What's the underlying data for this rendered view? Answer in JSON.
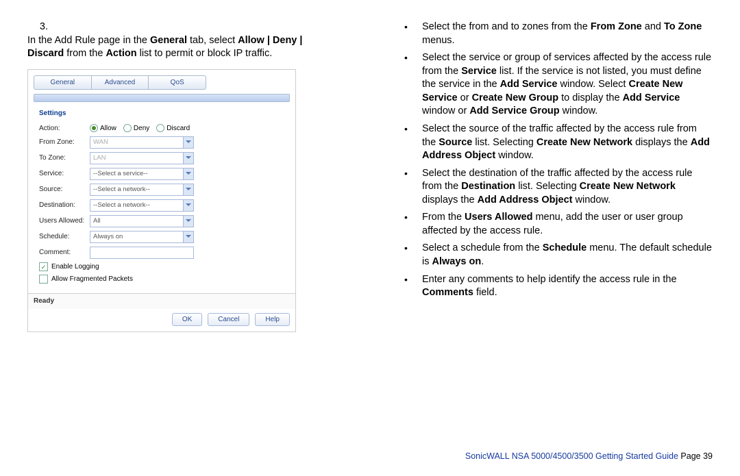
{
  "left": {
    "stepNumber": "3.",
    "stepText": {
      "pre": "In the Add Rule page in the ",
      "b1": "General",
      "mid1": " tab, select ",
      "b2": "Allow | Deny | Discard",
      "mid2": " from the ",
      "b3": "Action",
      "post": " list to permit or block IP traffic."
    }
  },
  "mock": {
    "tabs": [
      "General",
      "Advanced",
      "QoS"
    ],
    "sectionHeader": "Settings",
    "rows": {
      "action": {
        "label": "Action:",
        "opts": [
          "Allow",
          "Deny",
          "Discard"
        ]
      },
      "fromZone": {
        "label": "From Zone:",
        "value": "WAN"
      },
      "toZone": {
        "label": "To Zone:",
        "value": "LAN"
      },
      "service": {
        "label": "Service:",
        "value": "--Select a service--"
      },
      "source": {
        "label": "Source:",
        "value": "--Select a network--"
      },
      "destination": {
        "label": "Destination:",
        "value": "--Select a network--"
      },
      "usersAllowed": {
        "label": "Users Allowed:",
        "value": "All"
      },
      "schedule": {
        "label": "Schedule:",
        "value": "Always on"
      },
      "comment": {
        "label": "Comment:"
      }
    },
    "checks": {
      "enableLogging": "Enable Logging",
      "allowFragmented": "Allow Fragmented Packets"
    },
    "status": "Ready",
    "buttons": {
      "ok": "OK",
      "cancel": "Cancel",
      "help": "Help"
    }
  },
  "right": {
    "items": [
      {
        "t": [
          {
            "s": "Select the from and to zones from the "
          },
          {
            "b": "From Zone"
          },
          {
            "s": " and "
          },
          {
            "b": "To Zone"
          },
          {
            "s": " menus."
          }
        ]
      },
      {
        "t": [
          {
            "s": "Select the service or group of services affected by the access rule from the "
          },
          {
            "b": "Service"
          },
          {
            "s": " list. If the service is not listed, you must define the service in the "
          },
          {
            "b": "Add Service"
          },
          {
            "s": " window. Select "
          },
          {
            "b": "Create New Service"
          },
          {
            "s": " or "
          },
          {
            "b": "Create New Group"
          },
          {
            "s": " to display the "
          },
          {
            "b": "Add Service"
          },
          {
            "s": " window or "
          },
          {
            "b": "Add Service Group"
          },
          {
            "s": " window."
          }
        ]
      },
      {
        "t": [
          {
            "s": "Select the source of the traffic affected by the access rule from the "
          },
          {
            "b": "Source"
          },
          {
            "s": " list. Selecting "
          },
          {
            "b": "Create New Network"
          },
          {
            "s": " displays the "
          },
          {
            "b": "Add Address Object"
          },
          {
            "s": " window."
          }
        ]
      },
      {
        "t": [
          {
            "s": "Select the destination of the traffic affected by the access rule from the "
          },
          {
            "b": "Destination"
          },
          {
            "s": " list. Selecting "
          },
          {
            "b": "Create New Network"
          },
          {
            "s": " displays the "
          },
          {
            "b": "Add Address Object"
          },
          {
            "s": " window."
          }
        ]
      },
      {
        "t": [
          {
            "s": "From the "
          },
          {
            "b": "Users Allowed"
          },
          {
            "s": " menu, add the user or user group affected by the access rule."
          }
        ]
      },
      {
        "t": [
          {
            "s": "Select a schedule from the "
          },
          {
            "b": "Schedule"
          },
          {
            "s": " menu. The default schedule is "
          },
          {
            "b": "Always on"
          },
          {
            "s": "."
          }
        ]
      },
      {
        "t": [
          {
            "s": "Enter any comments to help identify the access rule in the "
          },
          {
            "b": "Comments"
          },
          {
            "s": " field."
          }
        ]
      }
    ]
  },
  "footer": {
    "link": "SonicWALL NSA 5000/4500/3500 Getting Started Guide",
    "page": "  Page 39"
  }
}
